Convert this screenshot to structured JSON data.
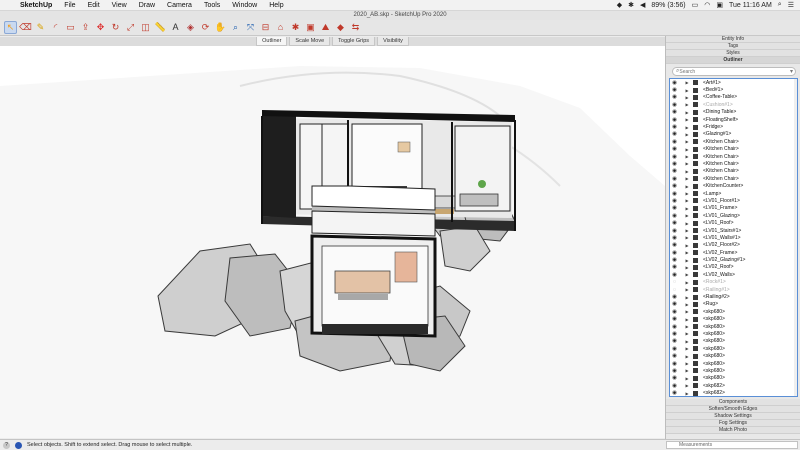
{
  "menubar": {
    "app": "SketchUp",
    "items": [
      "File",
      "Edit",
      "View",
      "Draw",
      "Camera",
      "Tools",
      "Window",
      "Help"
    ],
    "battery": "89% (3:56)",
    "clock": "Tue 11:16 AM"
  },
  "titlebar": {
    "title": "2020_AB.skp - SketchUp Pro 2020"
  },
  "scene_tabs": [
    "Outliner",
    "Scale Move",
    "Toggle Grips",
    "Visibility"
  ],
  "tray": {
    "headers_top": [
      "Entity Info",
      "Tags",
      "Styles",
      "Outliner"
    ],
    "search_placeholder": "Search",
    "headers_bottom": [
      "Components",
      "Soften/Smooth Edges",
      "Shadow Settings",
      "Fog Settings",
      "Match Photo"
    ]
  },
  "outliner_rows": [
    {
      "label": "<Art#1>",
      "hidden": false,
      "expandable": true
    },
    {
      "label": "<Bed#1>",
      "hidden": false,
      "expandable": true
    },
    {
      "label": "<Coffee-Table>",
      "hidden": false,
      "expandable": true
    },
    {
      "label": "<Cushion#1>",
      "hidden": false,
      "expandable": true,
      "dim": true
    },
    {
      "label": "<Dining Table>",
      "hidden": false,
      "expandable": true
    },
    {
      "label": "<FloatingShelf>",
      "hidden": false,
      "expandable": true
    },
    {
      "label": "<Fridge>",
      "hidden": false,
      "expandable": true
    },
    {
      "label": "<Glazing#1>",
      "hidden": false,
      "expandable": true
    },
    {
      "label": "<Kitchen Chair>",
      "hidden": false,
      "expandable": true
    },
    {
      "label": "<Kitchen Chair>",
      "hidden": false,
      "expandable": true
    },
    {
      "label": "<Kitchen Chair>",
      "hidden": false,
      "expandable": true
    },
    {
      "label": "<Kitchen Chair>",
      "hidden": false,
      "expandable": true
    },
    {
      "label": "<Kitchen Chair>",
      "hidden": false,
      "expandable": true
    },
    {
      "label": "<Kitchen Chair>",
      "hidden": false,
      "expandable": true
    },
    {
      "label": "<KitchenCounter>",
      "hidden": false,
      "expandable": true
    },
    {
      "label": "<Lamp>",
      "hidden": false,
      "expandable": true
    },
    {
      "label": "<LV01_Floor#1>",
      "hidden": false,
      "expandable": true
    },
    {
      "label": "<LV01_Frame>",
      "hidden": false,
      "expandable": true
    },
    {
      "label": "<LV01_Glazing>",
      "hidden": false,
      "expandable": true
    },
    {
      "label": "<LV01_Roof>",
      "hidden": false,
      "expandable": true
    },
    {
      "label": "<LV01_Stairs#1>",
      "hidden": false,
      "expandable": true
    },
    {
      "label": "<LV01_Walls#1>",
      "hidden": false,
      "expandable": true
    },
    {
      "label": "<LV02_Floor#2>",
      "hidden": false,
      "expandable": true
    },
    {
      "label": "<LV02_Frame>",
      "hidden": false,
      "expandable": true
    },
    {
      "label": "<LV02_Glazing#1>",
      "hidden": false,
      "expandable": true
    },
    {
      "label": "<LV02_Roof>",
      "hidden": false,
      "expandable": true
    },
    {
      "label": "<LV02_Walls>",
      "hidden": false,
      "expandable": true
    },
    {
      "label": "<Rock#1>",
      "hidden": true,
      "expandable": true,
      "dim": true
    },
    {
      "label": "<Railing#1>",
      "hidden": true,
      "expandable": true,
      "dim": true
    },
    {
      "label": "<Railing#2>",
      "hidden": false,
      "expandable": true
    },
    {
      "label": "<Rug>",
      "hidden": false,
      "expandable": true
    },
    {
      "label": "<skp680>",
      "hidden": false,
      "expandable": true
    },
    {
      "label": "<skp680>",
      "hidden": false,
      "expandable": true
    },
    {
      "label": "<skp680>",
      "hidden": false,
      "expandable": true
    },
    {
      "label": "<skp680>",
      "hidden": false,
      "expandable": true
    },
    {
      "label": "<skp680>",
      "hidden": false,
      "expandable": true
    },
    {
      "label": "<skp680>",
      "hidden": false,
      "expandable": true
    },
    {
      "label": "<skp680>",
      "hidden": false,
      "expandable": true
    },
    {
      "label": "<skp680>",
      "hidden": false,
      "expandable": true
    },
    {
      "label": "<skp680>",
      "hidden": false,
      "expandable": true
    },
    {
      "label": "<skp680>",
      "hidden": false,
      "expandable": true
    },
    {
      "label": "<skp682>",
      "hidden": false,
      "expandable": true
    },
    {
      "label": "<skp682>",
      "hidden": false,
      "expandable": true
    }
  ],
  "statusbar": {
    "hint": "Select objects. Shift to extend select. Drag mouse to select multiple.",
    "measurements_label": "Measurements"
  },
  "toolbar": {
    "tools": [
      "select-icon",
      "eraser-icon",
      "pencil-icon",
      "arc-icon",
      "shape-icon",
      "pushpull-icon",
      "move-icon",
      "rotate-icon",
      "scale-icon",
      "offset-icon",
      "tape-icon",
      "text-icon",
      "paint-icon",
      "orbit-icon",
      "pan-icon",
      "zoom-icon",
      "zoom-extents-icon",
      "section-icon",
      "warehouse-icon",
      "extension-icon",
      "layout-icon",
      "sandbox-icon",
      "ruby-icon",
      "flip-icon"
    ],
    "colors": [
      "#f0a020",
      "#c0392b",
      "#d9a100",
      "#c0392b",
      "#c0392b",
      "#c0392b",
      "#d33",
      "#c0392b",
      "#c0392b",
      "#c0392b",
      "#555",
      "#333",
      "#b03030",
      "#c0392b",
      "#1f8a3a",
      "#1f5fb0",
      "#1f5fb0",
      "#c0392b",
      "#c0392b",
      "#c0392b",
      "#c0392b",
      "#c0392b",
      "#c0392b",
      "#c0392b"
    ],
    "glyphs": [
      "↖",
      "⌫",
      "✎",
      "◜",
      "▭",
      "⇪",
      "✥",
      "↻",
      "⤢",
      "◫",
      "📏",
      "A",
      "◈",
      "⟳",
      "✋",
      "⌕",
      "⤧",
      "⊟",
      "⌂",
      "✱",
      "▣",
      "⛰",
      "◆",
      "⇆"
    ]
  }
}
